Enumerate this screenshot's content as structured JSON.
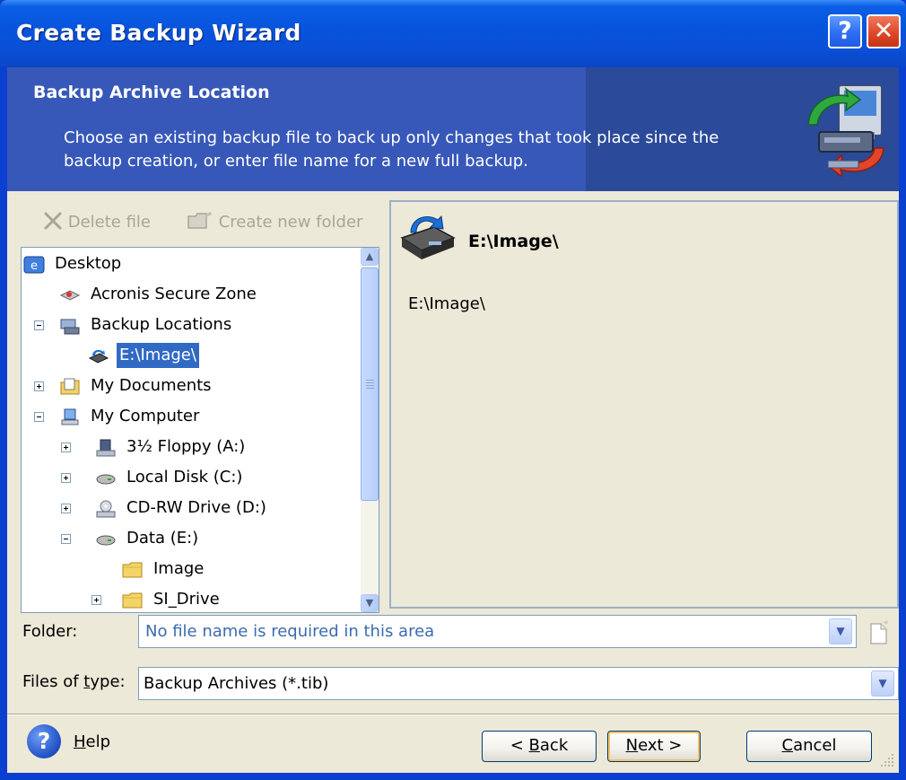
{
  "window": {
    "title": "Create Backup Wizard",
    "help_glyph": "?",
    "close_glyph": "✕"
  },
  "header": {
    "title": "Backup Archive Location",
    "description": "Choose an existing backup file to back up only changes that took place since the backup creation, or enter file name for a new full backup.",
    "icon": "backup-computer-icon"
  },
  "toolbar": {
    "delete_label": "Delete file",
    "create_folder_label": "Create new folder"
  },
  "tree": {
    "items": [
      {
        "label": "Desktop",
        "icon": "desktop-icon",
        "expander": "none",
        "selected": false
      },
      {
        "label": "Acronis Secure Zone",
        "icon": "secure-zone-icon",
        "expander": "none",
        "selected": false
      },
      {
        "label": "Backup Locations",
        "icon": "backup-locations-icon",
        "expander": "minus",
        "selected": false
      },
      {
        "label": "E:\\Image\\",
        "icon": "backup-drive-icon",
        "expander": "none",
        "selected": true
      },
      {
        "label": "My Documents",
        "icon": "documents-icon",
        "expander": "plus",
        "selected": false
      },
      {
        "label": "My Computer",
        "icon": "computer-icon",
        "expander": "minus",
        "selected": false
      },
      {
        "label": "3½ Floppy (A:)",
        "icon": "floppy-icon",
        "expander": "plus",
        "selected": false
      },
      {
        "label": "Local Disk (C:)",
        "icon": "disk-icon",
        "expander": "plus",
        "selected": false
      },
      {
        "label": "CD-RW Drive (D:)",
        "icon": "cd-drive-icon",
        "expander": "plus",
        "selected": false
      },
      {
        "label": "Data (E:)",
        "icon": "disk-icon",
        "expander": "minus",
        "selected": false
      },
      {
        "label": "Image",
        "icon": "folder-icon",
        "expander": "none",
        "selected": false
      },
      {
        "label": "SI_Drive",
        "icon": "folder-icon",
        "expander": "plus",
        "selected": false
      }
    ]
  },
  "details": {
    "title": "E:\\Image\\",
    "path": "E:\\Image\\"
  },
  "folder": {
    "label": "Folder:",
    "value": "No file name is required in this area"
  },
  "file_types": {
    "label_pre": "Files of ",
    "label_key": "t",
    "label_post": "ype:",
    "value": "Backup Archives (*.tib)"
  },
  "footer": {
    "help_key": "H",
    "help_rest": "elp",
    "back_pre": "< ",
    "back_key": "B",
    "back_rest": "ack",
    "next_key": "N",
    "next_rest": "ext >",
    "cancel_key": "C",
    "cancel_rest": "ancel"
  },
  "colors": {
    "titlebar": "#0853dc",
    "header_band": "#3758b9",
    "dialog_face": "#ece9d8",
    "selection": "#316ac5",
    "close_button": "#e0472a"
  }
}
